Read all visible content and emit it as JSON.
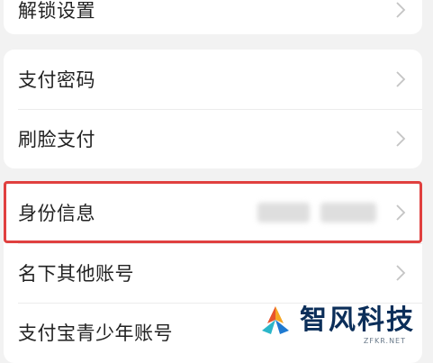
{
  "rows": [
    {
      "label": "解锁设置"
    },
    {
      "label": "支付密码"
    },
    {
      "label": "刷脸支付"
    },
    {
      "label": "身份信息"
    },
    {
      "label": "名下其他账号"
    },
    {
      "label": "支付宝青少年账号"
    }
  ],
  "watermark": {
    "text": "智风科技",
    "sub": "ZFKR.NET"
  },
  "colors": {
    "highlight": "#e0403f",
    "background": "#f2f2f2"
  }
}
